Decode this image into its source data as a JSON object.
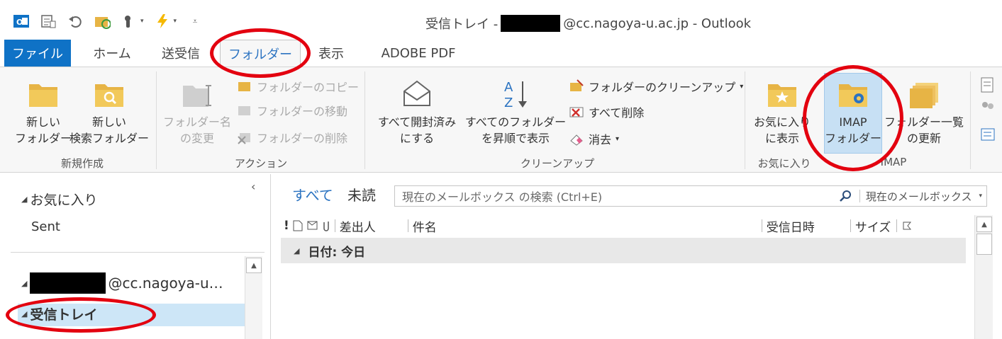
{
  "window": {
    "title_prefix": "受信トレイ -",
    "title_suffix": "@cc.nagoya-u.ac.jp - Outlook"
  },
  "quick_access": [
    {
      "icon": "outlook-logo-icon"
    },
    {
      "icon": "send-receive-icon"
    },
    {
      "icon": "undo-icon"
    },
    {
      "icon": "folder-sync-icon"
    },
    {
      "icon": "touch-mode-icon"
    },
    {
      "icon": "lightning-icon"
    },
    {
      "icon": "customize-qat-icon"
    }
  ],
  "tabs": [
    {
      "label": "ファイル"
    },
    {
      "label": "ホーム"
    },
    {
      "label": "送受信"
    },
    {
      "label": "フォルダー"
    },
    {
      "label": "表示"
    },
    {
      "label": "ADOBE PDF"
    }
  ],
  "ribbon": {
    "new_group": {
      "label": "新規作成",
      "new_folder": "新しい\nフォルダー",
      "new_search_folder": "新しい\n検索フォルダー"
    },
    "actions_group": {
      "label": "アクション",
      "rename": "フォルダー名\nの変更",
      "copy": "フォルダーのコピー",
      "move": "フォルダーの移動",
      "delete": "フォルダーの削除"
    },
    "cleanup_group": {
      "label": "クリーンアップ",
      "mark_all_read": "すべて開封済み\nにする",
      "sort_all": "すべてのフォルダー\nを昇順で表示",
      "cleanup_folder": "フォルダーのクリーンアップ",
      "delete_all": "すべて削除",
      "purge": "消去"
    },
    "favorites_group": {
      "label": "お気に入り",
      "show_in_favorites": "お気に入り\nに表示"
    },
    "imap_group": {
      "label": "IMAP",
      "imap_folders": "IMAP\nフォルダー",
      "update_list": "フォルダー一覧\nの更新"
    }
  },
  "nav": {
    "favorites": "お気に入り",
    "sent": "Sent",
    "account_suffix": "@cc.nagoya-u…",
    "inbox": "受信トレイ"
  },
  "mail": {
    "filter_all": "すべて",
    "filter_unread": "未読",
    "search_placeholder": "現在のメールボックス の検索 (Ctrl+E)",
    "search_scope": "現在のメールボックス",
    "columns": {
      "from": "差出人",
      "subject": "件名",
      "received": "受信日時",
      "size": "サイズ"
    },
    "group_header": "日付: 今日"
  },
  "colors": {
    "accent": "#0f72c6",
    "annotation": "#e3000f",
    "selection": "#cde6f7"
  }
}
